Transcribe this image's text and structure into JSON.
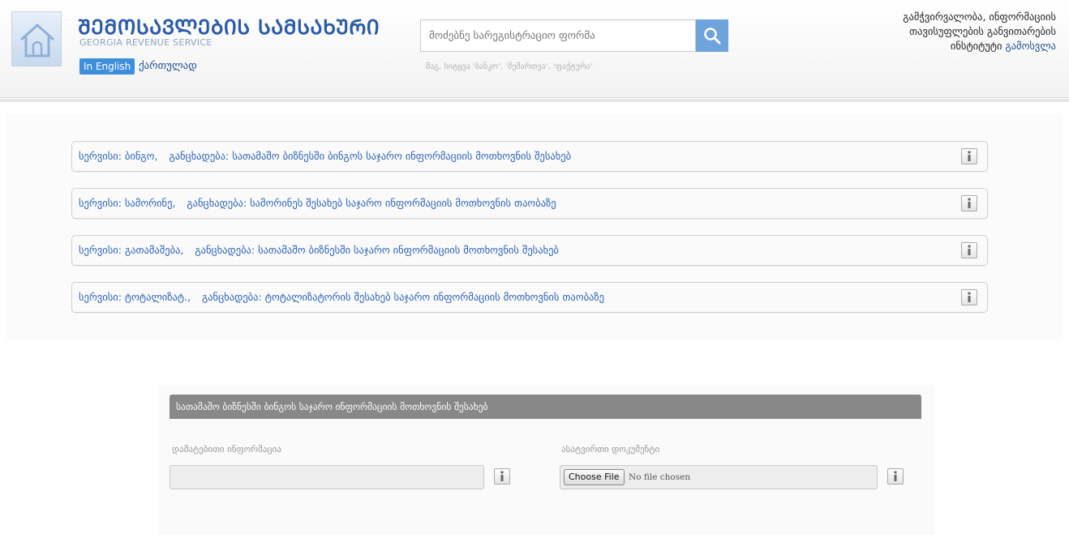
{
  "header": {
    "org_title": "ᲨᲔᲛᲝᲡᲐᲕᲚᲔᲑᲘᲡ ᲡᲐᲛᲡᲐᲮᲣᲠᲘ",
    "org_subtitle": "GEORGIA REVENUE SERVICE",
    "lang_english": "In English",
    "lang_georgian": "ქართულად",
    "search_placeholder": "მოძებნე სარეგისტრაციო ფორმა",
    "search_hint": "მაგ. სიტყვა 'ბანკო', 'შემართვა', 'ფაქტურა'",
    "user_line1": "გამჭვირვალობა, ინფორმაციის",
    "user_line2": "თავისუფლების განვითარების",
    "user_line3": "ინსტიტუტი",
    "logout": "გამოსვლა"
  },
  "services": [
    {
      "label": "სერვისი:",
      "name": "ბინგო,",
      "app_label": "განცხადება:",
      "desc": "სათამაშო ბიზნესში ბინგოს საჯარო ინფორმაციის მოთხოვნის შესახებ"
    },
    {
      "label": "სერვისი:",
      "name": "სამორინე,",
      "app_label": "განცხადება:",
      "desc": "სამორინეს შესახებ საჯარო ინფორმაციის მოთხოვნის თაობაზე"
    },
    {
      "label": "სერვისი:",
      "name": "გათამაშება,",
      "app_label": "განცხადება:",
      "desc": "სათამაშო ბიზნესში საჯარო ინფორმაციის მოთხოვნის შესახებ"
    },
    {
      "label": "სერვისი:",
      "name": "ტოტალიზატ.,",
      "app_label": "განცხადება:",
      "desc": "ტოტალიზატორის შესახებ საჯარო ინფორმაციის მოთხოვნის თაობაზე"
    }
  ],
  "form": {
    "title": "სათამაშო ბიზნესში ბინგოს საჯარო ინფორმაციის მოთხოვნის შესახებ",
    "additional_info_label": "დამატებითი ინფორმაცია",
    "additional_info_value": "",
    "attachment_label": "ასატვირთი დოკუმენტი",
    "choose_file": "Choose File",
    "no_file": "No file chosen"
  },
  "colors": {
    "accent": "#2a62b8",
    "search_button": "#6fa3dc",
    "form_header": "#888888"
  },
  "icons": {
    "logo": "house-icon",
    "search": "search-icon",
    "info": "info-icon"
  }
}
